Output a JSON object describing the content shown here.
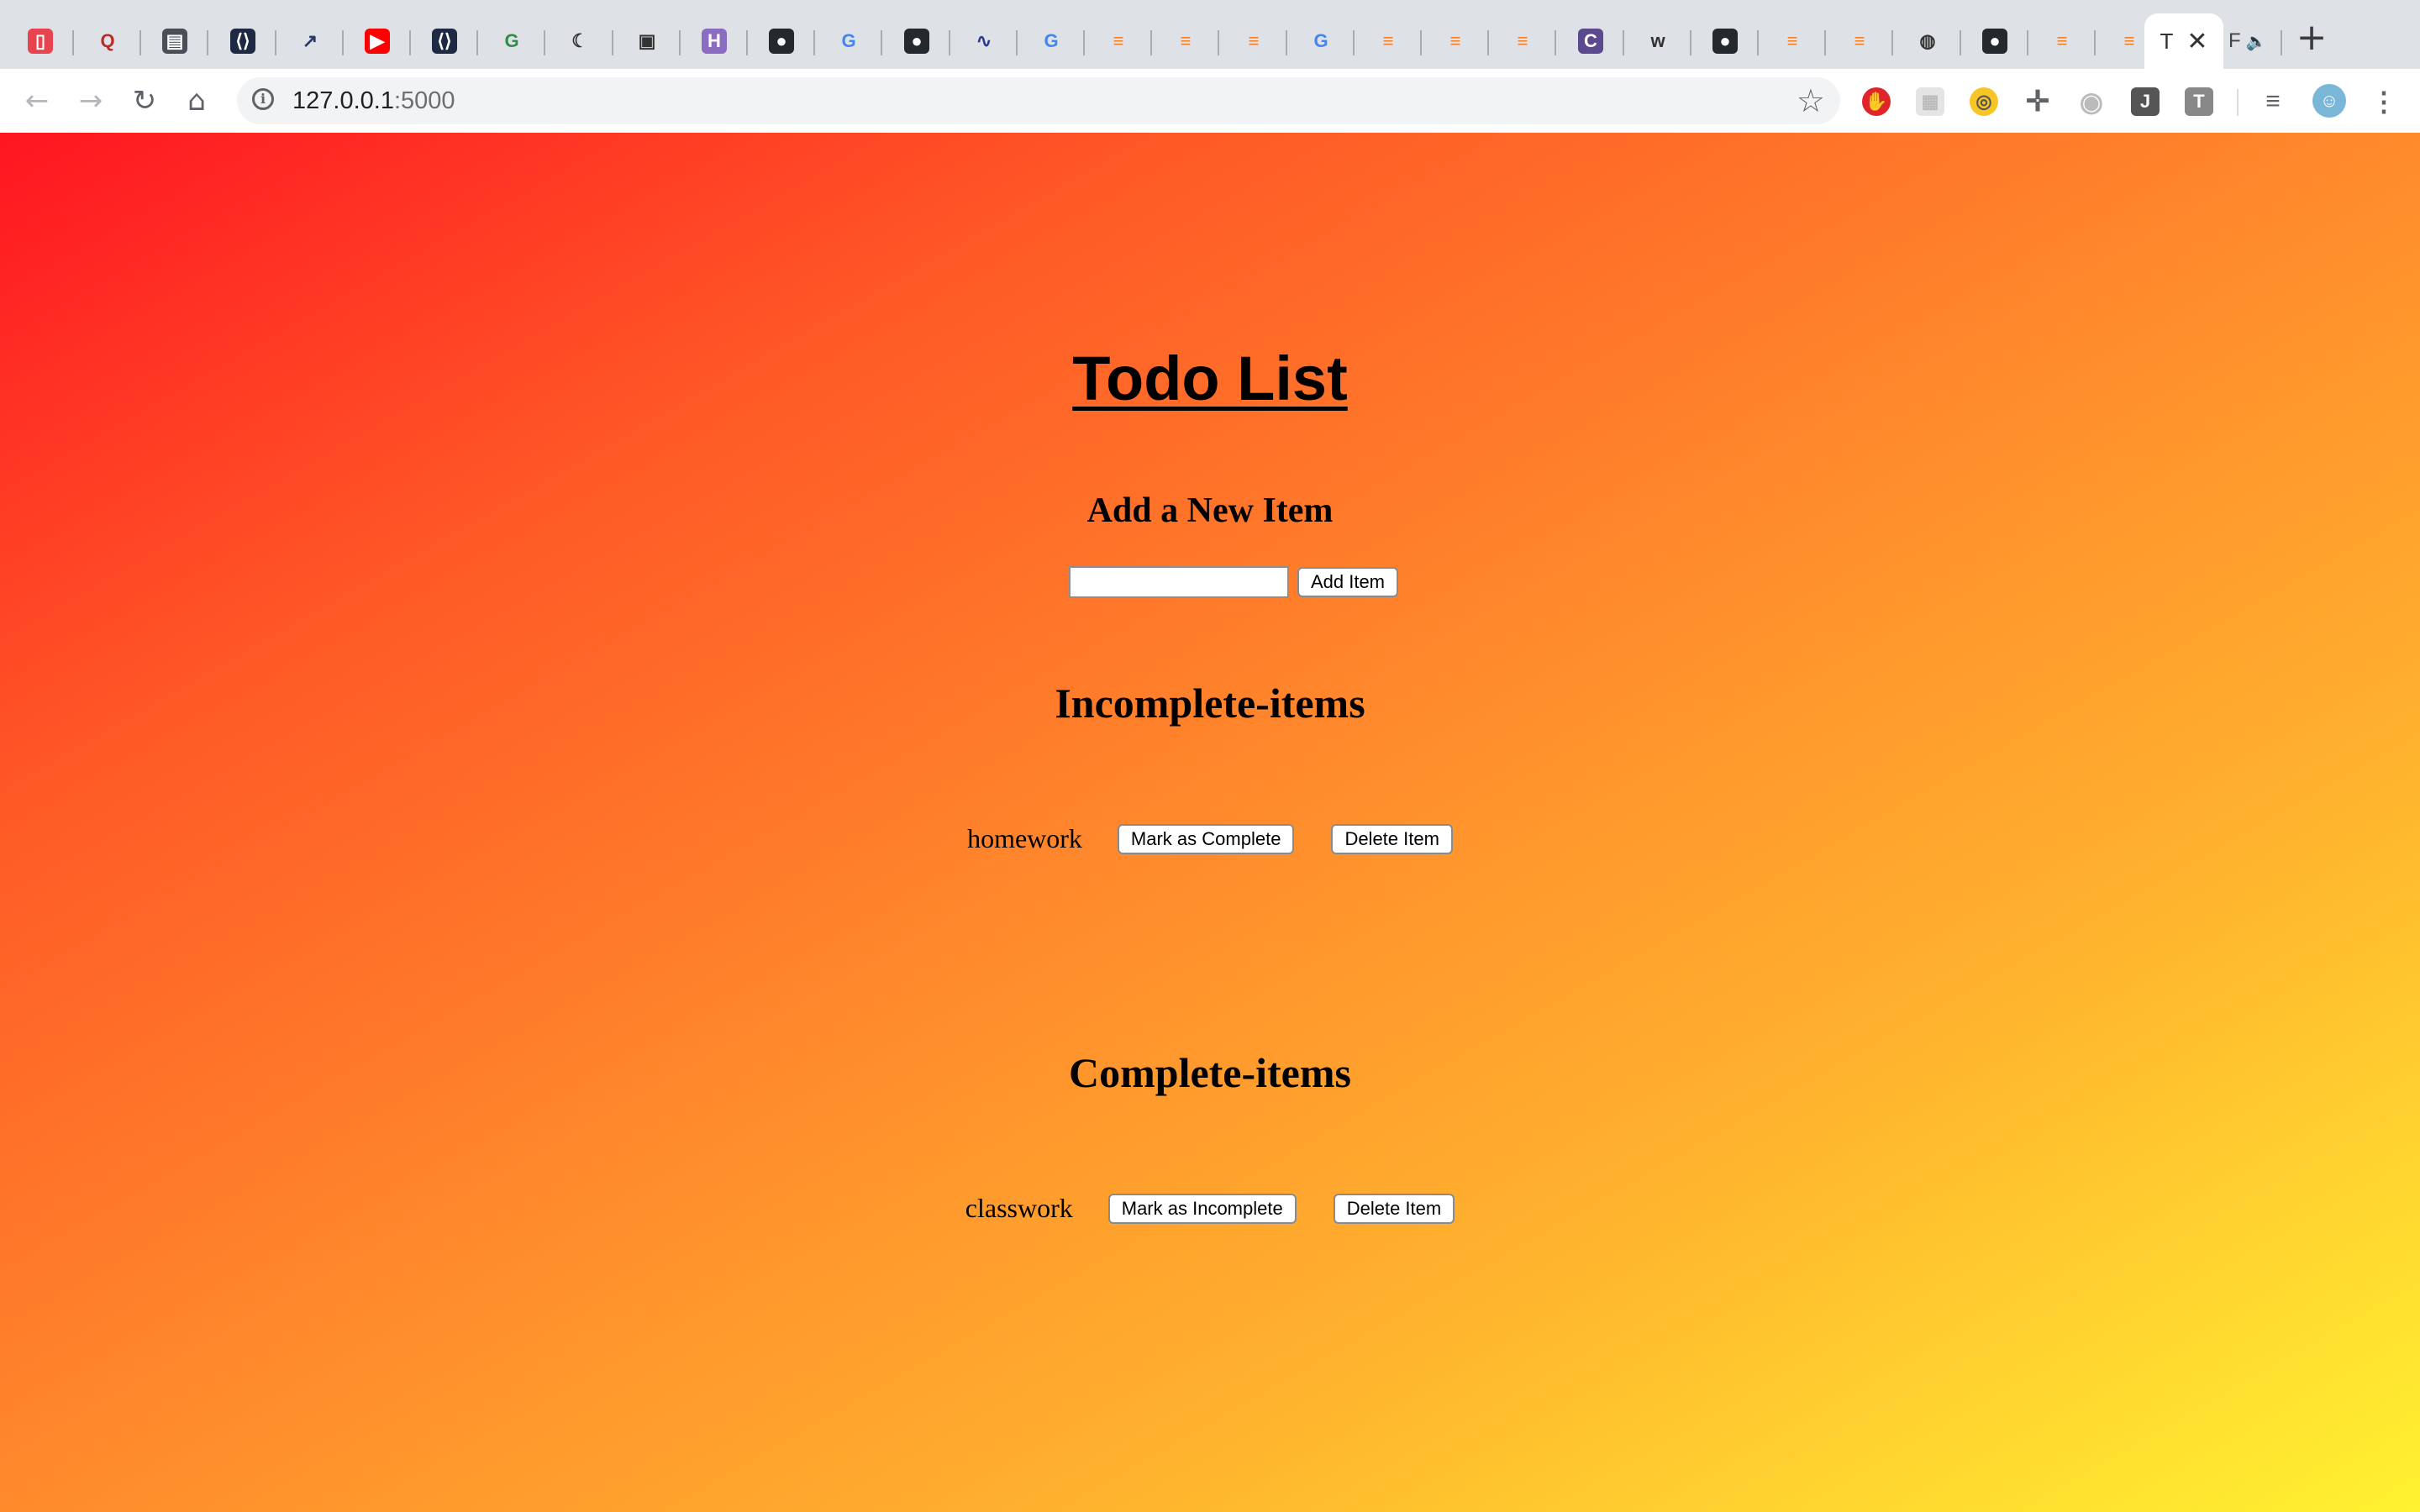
{
  "browser": {
    "tabs": [
      {
        "icon": "opera-red-icon",
        "color": "#e8444f"
      },
      {
        "icon": "quora-icon",
        "color": "#b92b27"
      },
      {
        "icon": "book-sidebar-icon",
        "color": "#4a4f57"
      },
      {
        "icon": "code-bracket-icon",
        "color": "#1e2a44"
      },
      {
        "icon": "trending-chart-icon",
        "color": "#2a3a66"
      },
      {
        "icon": "youtube-icon",
        "color": "#ff0000"
      },
      {
        "icon": "code-bracket-icon",
        "color": "#1e2a44"
      },
      {
        "icon": "geeksforgeeks-icon",
        "color": "#2f8d46"
      },
      {
        "icon": "sloth-icon",
        "color": "#333333"
      },
      {
        "icon": "camera-icon",
        "color": "#333333"
      },
      {
        "icon": "hackerrank-icon",
        "color": "#8a6cc1"
      },
      {
        "icon": "github-icon",
        "color": "#24292e"
      },
      {
        "icon": "google-icon",
        "color": "#4285f4"
      },
      {
        "icon": "github-icon",
        "color": "#24292e"
      },
      {
        "icon": "snake-icon",
        "color": "#2b3a8c"
      },
      {
        "icon": "google-icon",
        "color": "#4285f4"
      },
      {
        "icon": "stackoverflow-icon",
        "color": "#f48024"
      },
      {
        "icon": "stackoverflow-icon",
        "color": "#f48024"
      },
      {
        "icon": "stackoverflow-icon",
        "color": "#f48024"
      },
      {
        "icon": "google-icon",
        "color": "#4285f4"
      },
      {
        "icon": "stackoverflow-icon",
        "color": "#f48024"
      },
      {
        "icon": "stackoverflow-icon",
        "color": "#f48024"
      },
      {
        "icon": "stackoverflow-icon",
        "color": "#f48024"
      },
      {
        "icon": "c-circle-icon",
        "color": "#5c4a8e"
      },
      {
        "icon": "web-icon",
        "color": "#333333"
      },
      {
        "icon": "github-icon",
        "color": "#24292e"
      },
      {
        "icon": "stackoverflow-icon",
        "color": "#f48024"
      },
      {
        "icon": "stackoverflow-icon",
        "color": "#f48024"
      },
      {
        "icon": "globe-icon",
        "color": "#333333"
      },
      {
        "icon": "github-icon",
        "color": "#24292e"
      },
      {
        "icon": "stackoverflow-icon",
        "color": "#f48024"
      },
      {
        "icon": "stackoverflow-icon",
        "color": "#f48024"
      }
    ],
    "active_tab_char": "T",
    "last_tab_char": "F",
    "address_host": "127.0.0.1",
    "address_port": ":5000",
    "extension_j": "J",
    "extension_t": "T"
  },
  "page": {
    "title": "Todo List",
    "add_heading": "Add a New Item",
    "new_item_value": "",
    "add_button": "Add Item",
    "incomplete_heading": "Incomplete-items",
    "complete_heading": "Complete-items",
    "incomplete_items": [
      {
        "text": "homework",
        "toggle_label": "Mark as Complete",
        "delete_label": "Delete Item"
      }
    ],
    "complete_items": [
      {
        "text": "classwork",
        "toggle_label": "Mark as Incomplete",
        "delete_label": "Delete Item"
      }
    ],
    "gradient_start": "#ff1522",
    "gradient_end": "#fff230"
  }
}
